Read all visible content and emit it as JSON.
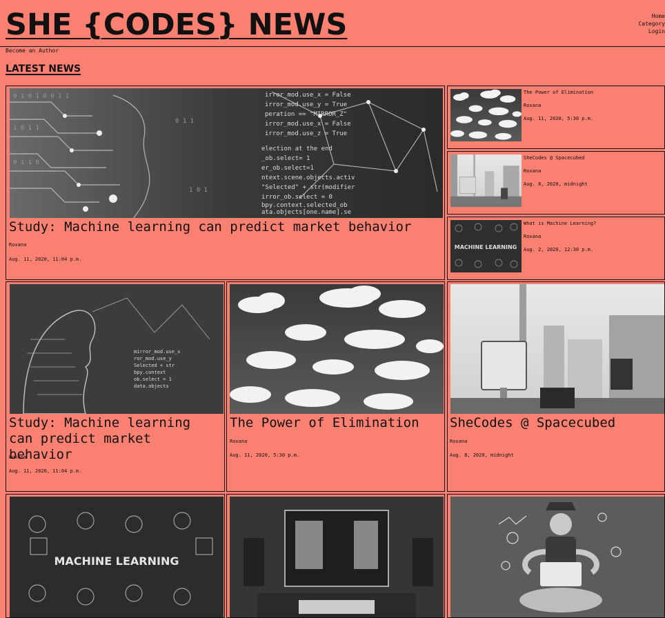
{
  "site": {
    "title": "SHE {CODES} NEWS"
  },
  "nav": {
    "items": [
      "Home",
      "Category",
      "Login"
    ]
  },
  "author_link": "Become an Author",
  "section_title": "LATEST NEWS",
  "featured": {
    "title": "Study: Machine learning can predict market behavior",
    "author": "Roxana",
    "date": "Aug. 11, 2020, 11:04 p.m.",
    "image_icon": "ai-face-code-image"
  },
  "side_list": [
    {
      "title": "The Power of Elimination",
      "author": "Roxana",
      "date": "Aug. 11, 2020, 5:30 p.m.",
      "image_icon": "clouds-image"
    },
    {
      "title": "SheCodes @ Spacecubed",
      "author": "Roxana",
      "date": "Aug. 8, 2020, midnight",
      "image_icon": "office-image"
    },
    {
      "title": "What is Machine Learning?",
      "author": "Roxana",
      "date": "Aug. 2, 2020, 12:30 p.m.",
      "image_icon": "machine-learning-image"
    }
  ],
  "grid": [
    {
      "title": "Study: Machine learning can predict market behavior",
      "author": "Roxana",
      "date": "Aug. 11, 2020, 11:04 p.m.",
      "image_icon": "ai-face-image"
    },
    {
      "title": "The Power of Elimination",
      "author": "Roxana",
      "date": "Aug. 11, 2020, 5:30 p.m.",
      "image_icon": "clouds-image"
    },
    {
      "title": "SheCodes @ Spacecubed",
      "author": "Roxana",
      "date": "Aug. 8, 2020, midnight",
      "image_icon": "office-image"
    }
  ],
  "grid_row2": [
    {
      "image_icon": "machine-learning-image",
      "image_text": "MACHINE LEARNING"
    },
    {
      "image_icon": "coding-desk-image"
    },
    {
      "image_icon": "meditating-developer-image"
    }
  ],
  "colors": {
    "background": "#FA8072",
    "border": "#111111"
  }
}
